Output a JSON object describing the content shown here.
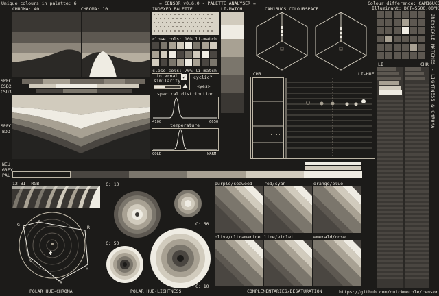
{
  "header": {
    "left": "Unique colours in palette: 6",
    "center": "= CENSOR v0.6.0 - PALETTE ANALYSER =",
    "right_line1": "Colour difference: CAM16UCS",
    "right_line2": "Illuminant: D(T=5500.00°K)"
  },
  "section_labels": {
    "chroma40": "CHROMA: 40",
    "chroma10": "CHROMA: 10",
    "indexed_palette": "INDEXED PALETTE",
    "li_match": "LI-MATCH",
    "cam16ucs": "CAM16UCS COLOURSPACE",
    "close_cols_10": "close cols: 10% li-match",
    "close_cols_70": "close cols: 70% li-match",
    "internal_similarity": "internal\nsimilarity",
    "cyclic": "cyclic?",
    "cyclic_value": "<yes>",
    "spectral": "spectral distribution",
    "spectral_min": "4100",
    "spectral_max": "6650",
    "temperature": "temperature",
    "cold": "COLD",
    "warm": "WARM",
    "chr_left": "CHR",
    "li_hue": "LI-HUE",
    "li": "LI",
    "chr_right": "CHR",
    "spec": "SPEC",
    "csd2": "CSD2",
    "csd3": "CSD3",
    "spec2": "SPEC",
    "bdd": "BDD",
    "neu_grey": "NEU\nGREY",
    "pal": "PAL",
    "bit12": "12 BIT RGB",
    "c10a": "C: 10",
    "c50a": "C: 50",
    "c50b": "C: 50",
    "c10b": "C: 10",
    "polar_hc": "POLAR HUE-CHROMA",
    "polar_hl": "POLAR HUE-LIGHTNESS",
    "complementaries": "COMPLEMENTARIES/DESATURATION",
    "url": "https://github.com/quickmorble/censor",
    "right_vertical": "GREYSCALE MATCHES - LIGHTNESS & CHROMA"
  },
  "pair_labels": [
    "purple/seaweed",
    "red/cyan",
    "orange/blue",
    "olive/ultramarine",
    "lime/violet",
    "emerald/rose"
  ],
  "polar_letters": [
    "G",
    "Y",
    "R",
    "C",
    "B",
    "M"
  ],
  "palette": [
    "#1c1b19",
    "#4a4641",
    "#7b766c",
    "#a8a193",
    "#d1cbbd",
    "#efece3"
  ]
}
